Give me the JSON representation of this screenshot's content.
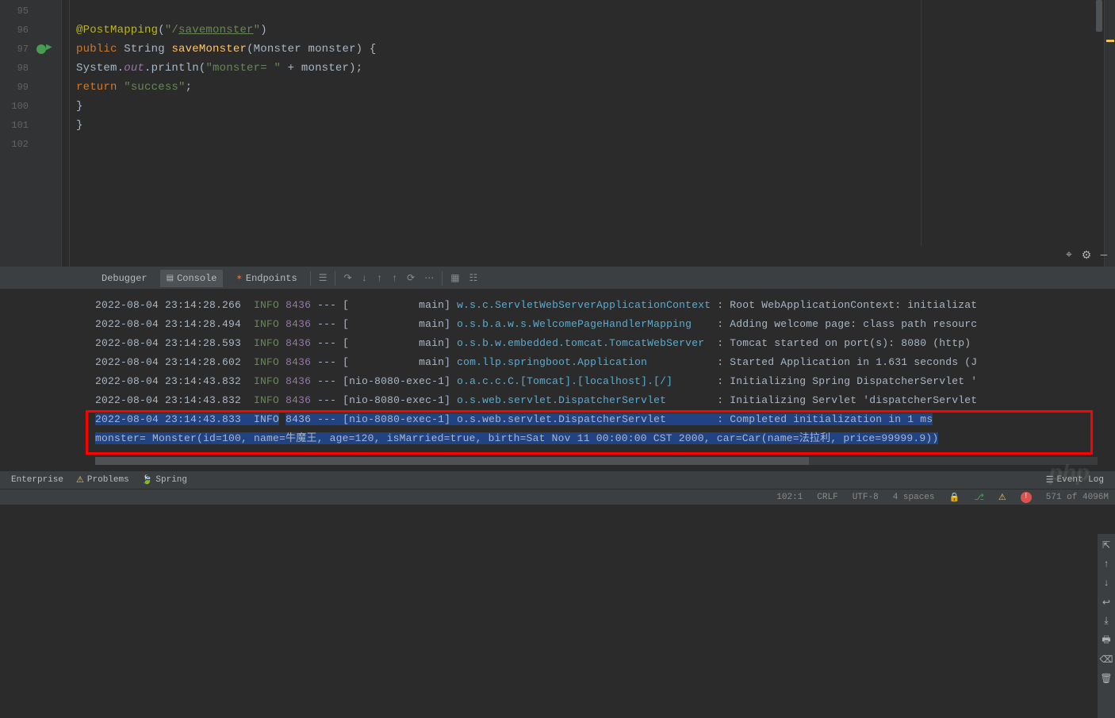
{
  "gutter": {
    "lines": [
      "95",
      "96",
      "97",
      "98",
      "99",
      "100",
      "101",
      "102"
    ]
  },
  "code": {
    "l96_ann": "@PostMapping",
    "l96_str": "\"/savemonster\"",
    "l96_str_a": "\"/",
    "l96_str_b": "savemonster",
    "l96_str_c": "\"",
    "l97_kw": "public",
    "l97_type": "String",
    "l97_method": "saveMonster",
    "l97_params": "(Monster monster) {",
    "l98_sys": "System.",
    "l98_out": "out",
    "l98_call": ".println(",
    "l98_str": "\"monster= \"",
    "l98_rest": " + monster);",
    "l99_kw": "return",
    "l99_str": "\"success\"",
    "l99_end": ";",
    "l100": "}",
    "l101": "}"
  },
  "debug_tabs": {
    "debugger": "Debugger",
    "console": "Console",
    "endpoints": "Endpoints"
  },
  "logs": [
    {
      "ts": "2022-08-04 23:14:28.266",
      "level": "INFO",
      "pid": "8436",
      "th": "[           main]",
      "lg": "w.s.c.ServletWebServerApplicationContext",
      "msg": ": Root WebApplicationContext: initializat"
    },
    {
      "ts": "2022-08-04 23:14:28.494",
      "level": "INFO",
      "pid": "8436",
      "th": "[           main]",
      "lg": "o.s.b.a.w.s.WelcomePageHandlerMapping   ",
      "msg": ": Adding welcome page: class path resourc"
    },
    {
      "ts": "2022-08-04 23:14:28.593",
      "level": "INFO",
      "pid": "8436",
      "th": "[           main]",
      "lg": "o.s.b.w.embedded.tomcat.TomcatWebServer ",
      "msg": ": Tomcat started on port(s): 8080 (http) "
    },
    {
      "ts": "2022-08-04 23:14:28.602",
      "level": "INFO",
      "pid": "8436",
      "th": "[           main]",
      "lg": "com.llp.springboot.Application          ",
      "msg": ": Started Application in 1.631 seconds (J"
    },
    {
      "ts": "2022-08-04 23:14:43.832",
      "level": "INFO",
      "pid": "8436",
      "th": "[nio-8080-exec-1]",
      "lg": "o.a.c.c.C.[Tomcat].[localhost].[/]      ",
      "msg": ": Initializing Spring DispatcherServlet '"
    },
    {
      "ts": "2022-08-04 23:14:43.832",
      "level": "INFO",
      "pid": "8436",
      "th": "[nio-8080-exec-1]",
      "lg": "o.s.web.servlet.DispatcherServlet       ",
      "msg": ": Initializing Servlet 'dispatcherServlet"
    },
    {
      "ts": "2022-08-04 23:14:43.833",
      "level": "INFO",
      "pid": "8436",
      "th": "[nio-8080-exec-1]",
      "lg": "o.s.web.servlet.DispatcherServlet       ",
      "msg": ": Completed initialization in 1 ms"
    }
  ],
  "output_line": "monster= Monster(id=100, name=牛魔王, age=120, isMarried=true, birth=Sat Nov 11 00:00:00 CST 2000, car=Car(name=法拉利, price=99999.9))",
  "tool_windows": {
    "enterprise": "Enterprise",
    "problems": "Problems",
    "spring": "Spring"
  },
  "eventlog": "Event Log",
  "status": {
    "pos": "102:1",
    "crlf": "CRLF",
    "enc": "UTF-8",
    "indent": "4 spaces",
    "mem": "571 of 4096M"
  },
  "watermark": "php"
}
